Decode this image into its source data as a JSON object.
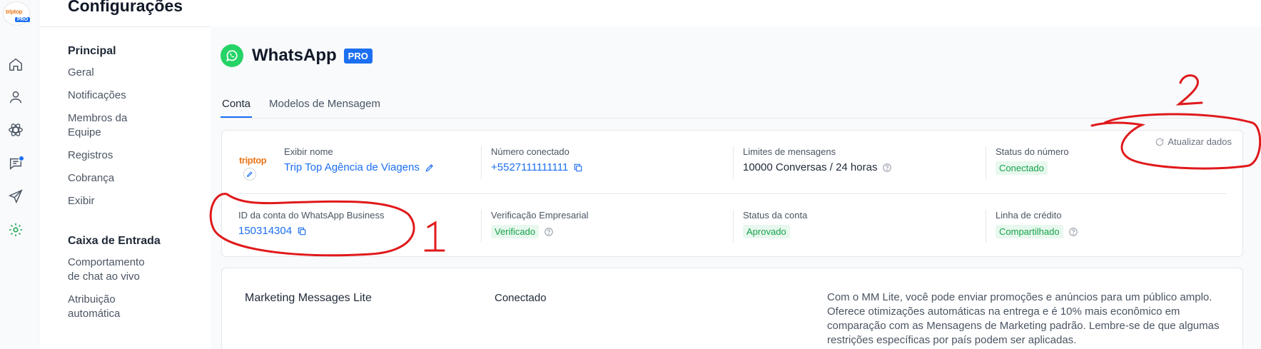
{
  "app": {
    "logo_text": "triptop",
    "logo_badge": "PRO"
  },
  "rail": {
    "icons": [
      "home-icon",
      "user-icon",
      "atom-icon",
      "chat-icon",
      "send-icon",
      "settings-icon"
    ]
  },
  "header": {
    "title": "Configurações"
  },
  "nav": {
    "sections": [
      {
        "title": "Principal",
        "items": [
          "Geral",
          "Notificações",
          "Membros da Equipe",
          "Registros",
          "Cobrança",
          "Exibir"
        ]
      },
      {
        "title": "Caixa de Entrada",
        "items": [
          "Comportamento de chat ao vivo",
          "Atribuição automática"
        ]
      }
    ]
  },
  "whatsapp": {
    "title": "WhatsApp",
    "badge": "PRO",
    "tabs": [
      "Conta",
      "Modelos de Mensagem"
    ],
    "refresh_label": "Atualizar dados",
    "business_logo_text": "triptop",
    "fields": {
      "display_name": {
        "label": "Exibir nome",
        "value": "Trip Top Agência de Viagens"
      },
      "connected_number": {
        "label": "Número conectado",
        "value": "+5527111111111"
      },
      "message_limits": {
        "label": "Limites de mensagens",
        "value": "10000 Conversas / 24 horas"
      },
      "number_status": {
        "label": "Status do número",
        "value": "Conectado"
      },
      "business_account_id": {
        "label": "ID da conta do WhatsApp Business",
        "value": "150314304"
      },
      "business_verification": {
        "label": "Verificação Empresarial",
        "value": "Verificado"
      },
      "account_status": {
        "label": "Status da conta",
        "value": "Aprovado"
      },
      "credit_line": {
        "label": "Linha de crédito",
        "value": "Compartilhado"
      }
    },
    "marketing": {
      "title": "Marketing Messages Lite",
      "status": "Conectado",
      "description": "Com o MM Lite, você pode enviar promoções e anúncios para um público amplo. Oferece otimizações automáticas na entrega e é 10% mais econômico em comparação com as Mensagens de Marketing padrão. Lembre-se de que algumas restrições específicas por país podem ser aplicadas."
    }
  },
  "annotations": {
    "one": "1",
    "two": "2",
    "color": "#e0191b"
  },
  "colors": {
    "accent": "#1d6ff2",
    "whatsapp": "#25d366",
    "success_bg": "#e8f8ee",
    "success_text": "#16a34a"
  }
}
